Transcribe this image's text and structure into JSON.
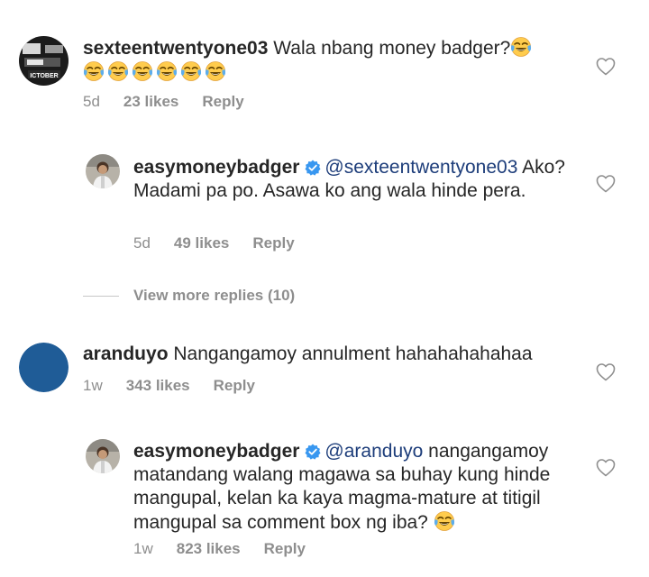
{
  "comments": [
    {
      "username": "sexteentwentyone03",
      "text": "Wala nbang money badger?",
      "emoji_name": "face-with-tears-of-joy",
      "emoji_count": 7,
      "time": "5d",
      "likes": "23 likes",
      "reply": "Reply",
      "avatar_text": [
        "ICTOBER"
      ]
    },
    {
      "username": "easymoneybadger",
      "verified": true,
      "mention": "@sexteentwentyone03",
      "text": "Ako? Madami pa po. Asawa ko ang wala hinde pera.",
      "time": "5d",
      "likes": "49 likes",
      "reply": "Reply"
    },
    {
      "username": "aranduyo",
      "text": "Nangangamoy annulment hahahahahahaa",
      "time": "1w",
      "likes": "343 likes",
      "reply": "Reply",
      "avatar_color": "#1f5c97"
    },
    {
      "username": "easymoneybadger",
      "verified": true,
      "mention": "@aranduyo",
      "text": "nangangamoy matandang walang magawa sa buhay kung hinde mangupal, kelan ka kaya magma-mature at titigil mangupal sa comment box ng iba?",
      "emoji_name": "face-with-tears-of-joy",
      "emoji_count": 1,
      "time": "1w",
      "likes": "823 likes",
      "reply": "Reply"
    }
  ],
  "view_more": "View more replies (10)",
  "colors": {
    "text": "#262626",
    "meta": "#8e8e8e",
    "mention": "#1d3d7a",
    "verified": "#3897f0"
  }
}
